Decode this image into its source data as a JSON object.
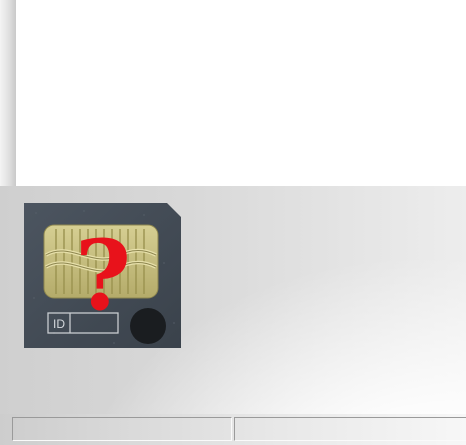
{
  "card": {
    "id_label": "ID",
    "overlay_glyph": "?"
  },
  "status_bar": {
    "pane_1_text": "",
    "pane_2_text": ""
  }
}
